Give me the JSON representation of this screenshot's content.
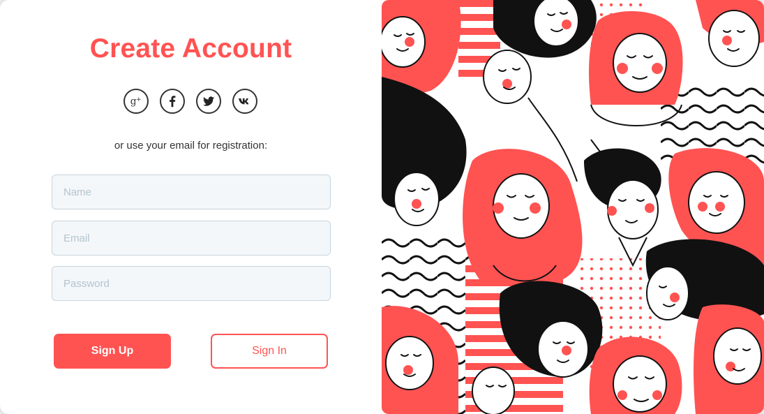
{
  "form": {
    "title": "Create Account",
    "subtitle": "or use your email for registration:",
    "fields": {
      "name_placeholder": "Name",
      "email_placeholder": "Email",
      "password_placeholder": "Password"
    },
    "buttons": {
      "sign_up": "Sign Up",
      "sign_in": "Sign In"
    }
  },
  "socials": [
    {
      "icon": "google-plus-icon"
    },
    {
      "icon": "facebook-icon"
    },
    {
      "icon": "twitter-icon"
    },
    {
      "icon": "vk-icon"
    }
  ],
  "colors": {
    "accent": "#ff5352",
    "field_bg": "#f4f7f9",
    "field_border": "#c6d4de",
    "text": "#333333"
  },
  "illustration": {
    "icon": "people-crowd-illustration"
  }
}
